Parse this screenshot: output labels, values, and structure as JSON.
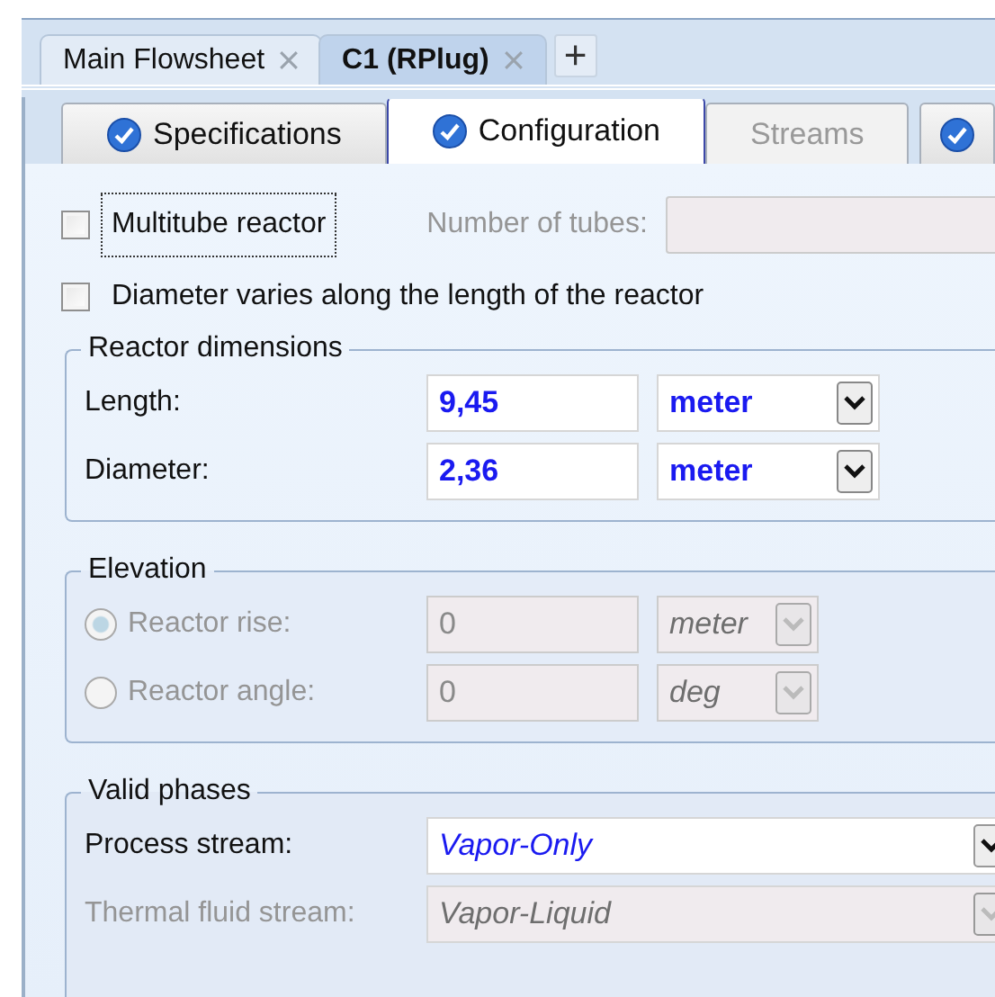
{
  "doc_tabs": [
    {
      "label": "Main Flowsheet",
      "selected": false
    },
    {
      "label": "C1 (RPlug)",
      "selected": true
    }
  ],
  "add_tab": "+",
  "tabs": [
    {
      "label": "Specifications",
      "complete": true,
      "selected": false
    },
    {
      "label": "Configuration",
      "complete": true,
      "selected": true
    },
    {
      "label": "Streams",
      "complete": false,
      "selected": false
    },
    {
      "complete": true,
      "selected": false
    }
  ],
  "multitube": {
    "label": "Multitube reactor",
    "checked": false,
    "focused": true
  },
  "tubes": {
    "label": "Number of tubes:",
    "disabled": true
  },
  "diameter_varies": {
    "label": "Diameter varies along the length of the reactor",
    "checked": false
  },
  "dimensions": {
    "title": "Reactor dimensions",
    "rows": [
      {
        "label": "Length:",
        "value": "9,45",
        "unit": "meter",
        "disabled": false
      },
      {
        "label": "Diameter:",
        "value": "2,36",
        "unit": "meter",
        "disabled": false
      }
    ]
  },
  "elevation": {
    "title": "Elevation",
    "rows": [
      {
        "label": "Reactor rise:",
        "value": "0",
        "unit": "meter",
        "selected": true,
        "disabled": true
      },
      {
        "label": "Reactor angle:",
        "value": "0",
        "unit": "deg",
        "selected": false,
        "disabled": true
      }
    ]
  },
  "valid_phases": {
    "title": "Valid phases",
    "rows": [
      {
        "label": "Process stream:",
        "value": "Vapor-Only",
        "disabled": false
      },
      {
        "label": "Thermal fluid stream:",
        "value": "Vapor-Liquid",
        "disabled": true
      }
    ]
  }
}
